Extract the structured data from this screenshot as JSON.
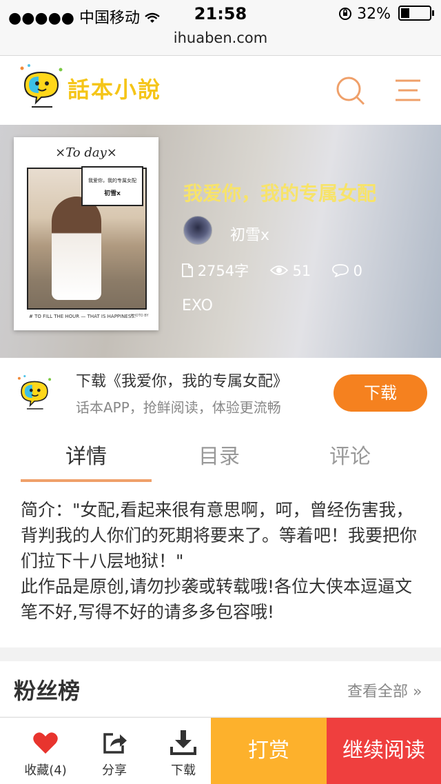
{
  "status_bar": {
    "carrier": "●●●●● 中国移动",
    "time": "21:58",
    "battery": "32%"
  },
  "url": "ihuaben.com",
  "header": {
    "logo_text": "話本小說"
  },
  "book": {
    "cover": {
      "today": "×To day×",
      "title_line": "我爱你，我的专属女配",
      "author_line": "初雪x",
      "footer": "TO FILL THE HOUR — THAT IS HAPPINESS.",
      "footer_right": "PHOTO BY"
    },
    "title": "我爱你，我的专属女配",
    "author": "初雪x",
    "words": "2754字",
    "views": "51",
    "comments": "0",
    "tag": "EXO"
  },
  "download_banner": {
    "title": "下载《我爱你，我的专属女配》",
    "subtitle": "话本APP，抢鲜阅读，体验更流畅",
    "button": "下载"
  },
  "tabs": [
    {
      "label": "详情",
      "active": true
    },
    {
      "label": "目录",
      "active": false
    },
    {
      "label": "评论",
      "active": false
    }
  ],
  "summary": "简介：\"女配,看起来很有意思啊，呵，曾经伤害我，背判我的人你们的死期将要来了。等着吧！我要把你们拉下十八层地狱！\"\n此作品是原创,请勿抄袭或转载哦!各位大侠本逗逼文笔不好,写得不好的请多多包容哦!",
  "fans": {
    "title": "粉丝榜",
    "more": "查看全部 »"
  },
  "toolbar": {
    "favorite": "收藏(4)",
    "share": "分享",
    "download": "下载",
    "reward": "打赏",
    "continue": "继续阅读"
  },
  "colors": {
    "accent_orange": "#f5811f",
    "title_yellow": "#f7e36a",
    "reward": "#fdb12c",
    "continue": "#ef3f3e",
    "heart": "#e8342e"
  }
}
